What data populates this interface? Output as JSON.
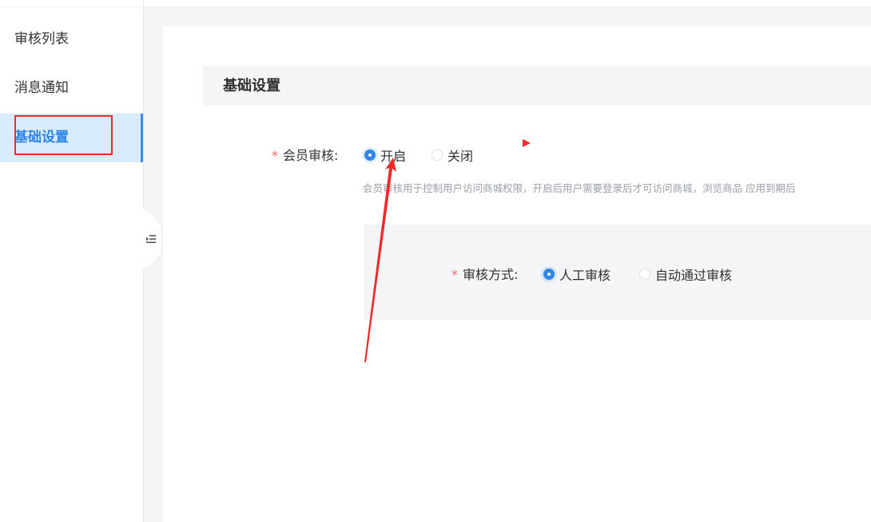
{
  "sidebar": {
    "items": [
      {
        "label": "审核列表"
      },
      {
        "label": "消息通知"
      },
      {
        "label": "基础设置",
        "active": true
      }
    ]
  },
  "section": {
    "title": "基础设置"
  },
  "member_review": {
    "required_mark": "*",
    "label": "会员审核:",
    "options": [
      {
        "label": "开启",
        "checked": true
      },
      {
        "label": "关闭",
        "checked": false
      }
    ],
    "help_text": "会员审核用于控制用户访问商城权限，开启后用户需要登录后才可访问商城，浏览商品 应用到期后"
  },
  "review_method": {
    "required_mark": "*",
    "label": "审核方式:",
    "options": [
      {
        "label": "人工审核",
        "checked": true
      },
      {
        "label": "自动通过审核",
        "checked": false
      }
    ]
  },
  "colors": {
    "accent": "#2f86e8",
    "annotation_red": "#ee2a2a",
    "active_bg": "#d8ecfd"
  },
  "icons": {
    "collapse": "collapse-sidebar-icon"
  }
}
